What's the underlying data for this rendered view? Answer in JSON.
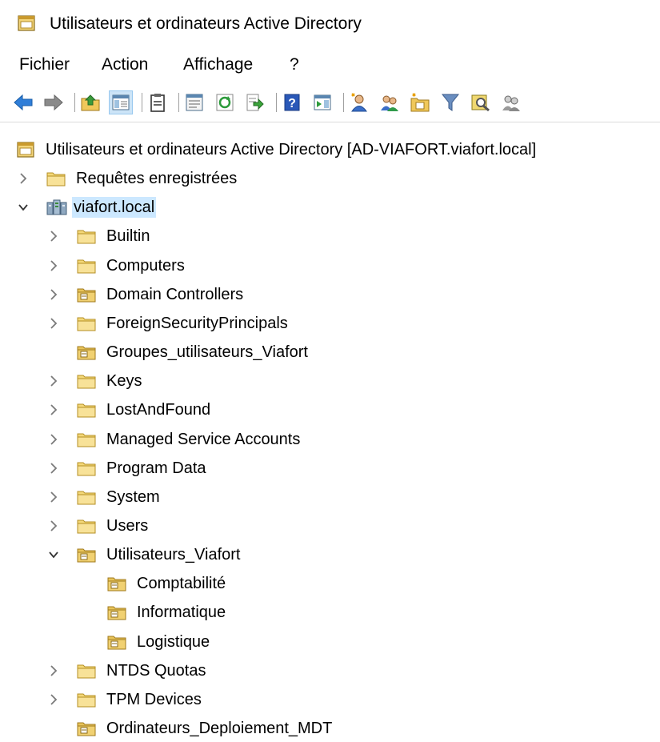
{
  "window": {
    "title": "Utilisateurs et ordinateurs Active Directory"
  },
  "menu": [
    "Fichier",
    "Action",
    "Affichage",
    "?"
  ],
  "toolbar": [
    {
      "icon": "back-arrow-icon"
    },
    {
      "icon": "forward-arrow-icon"
    },
    {
      "sep": true
    },
    {
      "icon": "up-folder-icon"
    },
    {
      "icon": "console-tree-icon",
      "pressed": true
    },
    {
      "sep": true
    },
    {
      "icon": "clipboard-icon"
    },
    {
      "sep": true
    },
    {
      "icon": "properties-icon"
    },
    {
      "icon": "refresh-icon"
    },
    {
      "icon": "export-list-icon"
    },
    {
      "sep": true
    },
    {
      "icon": "help-icon"
    },
    {
      "icon": "action-pane-icon"
    },
    {
      "sep": true
    },
    {
      "icon": "new-user-icon"
    },
    {
      "icon": "new-group-icon"
    },
    {
      "icon": "new-ou-icon"
    },
    {
      "icon": "filter-icon"
    },
    {
      "icon": "find-icon"
    },
    {
      "icon": "add-to-group-icon"
    }
  ],
  "tree": [
    {
      "label": "Utilisateurs et ordinateurs Active Directory [AD-VIAFORT.viafort.local]",
      "level": 0,
      "icon": "snapin",
      "chevron": "none"
    },
    {
      "label": "Requêtes enregistrées",
      "level": 1,
      "icon": "folder",
      "chevron": "right"
    },
    {
      "label": "viafort.local",
      "level": 1,
      "icon": "domain",
      "chevron": "down",
      "selected": true
    },
    {
      "label": "Builtin",
      "level": 2,
      "icon": "folder",
      "chevron": "right"
    },
    {
      "label": "Computers",
      "level": 2,
      "icon": "folder",
      "chevron": "right"
    },
    {
      "label": "Domain Controllers",
      "level": 2,
      "icon": "ou",
      "chevron": "right"
    },
    {
      "label": "ForeignSecurityPrincipals",
      "level": 2,
      "icon": "folder",
      "chevron": "right"
    },
    {
      "label": "Groupes_utilisateurs_Viafort",
      "level": 2,
      "icon": "ou",
      "chevron": "none"
    },
    {
      "label": "Keys",
      "level": 2,
      "icon": "folder",
      "chevron": "right"
    },
    {
      "label": "LostAndFound",
      "level": 2,
      "icon": "folder",
      "chevron": "right"
    },
    {
      "label": "Managed Service Accounts",
      "level": 2,
      "icon": "folder",
      "chevron": "right"
    },
    {
      "label": "Program Data",
      "level": 2,
      "icon": "folder",
      "chevron": "right"
    },
    {
      "label": "System",
      "level": 2,
      "icon": "folder",
      "chevron": "right"
    },
    {
      "label": "Users",
      "level": 2,
      "icon": "folder",
      "chevron": "right"
    },
    {
      "label": "Utilisateurs_Viafort",
      "level": 2,
      "icon": "ou",
      "chevron": "down"
    },
    {
      "label": "Comptabilité",
      "level": 3,
      "icon": "ou",
      "chevron": "none"
    },
    {
      "label": "Informatique",
      "level": 3,
      "icon": "ou",
      "chevron": "none"
    },
    {
      "label": "Logistique",
      "level": 3,
      "icon": "ou",
      "chevron": "none"
    },
    {
      "label": "NTDS Quotas",
      "level": 2,
      "icon": "folder",
      "chevron": "right"
    },
    {
      "label": "TPM Devices",
      "level": 2,
      "icon": "folder",
      "chevron": "right"
    },
    {
      "label": "Ordinateurs_Deploiement_MDT",
      "level": 2,
      "icon": "ou",
      "chevron": "none"
    }
  ]
}
